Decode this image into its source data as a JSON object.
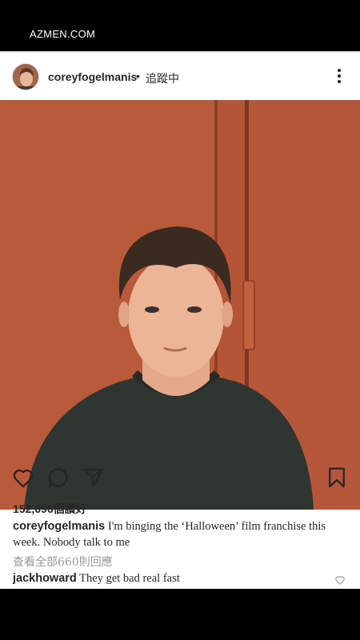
{
  "site": {
    "label": "AZMEN.COM"
  },
  "post": {
    "username": "coreyfogelmanis",
    "dot": "•",
    "follow_status": "追蹤中",
    "likes_count": "152,696",
    "likes_suffix": "個讚好",
    "caption_user": "coreyfogelmanis",
    "caption_text": "I'm binging the ‘Halloween’ film franchise this week. Nobody talk to me",
    "view_all_comments": "查看全部660則回應",
    "comment": {
      "user": "jackhoward",
      "text": "They get bad real fast"
    }
  },
  "icons": {
    "more": "more-vertical-icon",
    "like": "heart-icon",
    "comment": "comment-icon",
    "share": "send-icon",
    "save": "bookmark-icon"
  },
  "colors": {
    "wall": "#b95a3a",
    "sweater": "#2f3530",
    "text": "#262626",
    "muted": "#999999"
  }
}
